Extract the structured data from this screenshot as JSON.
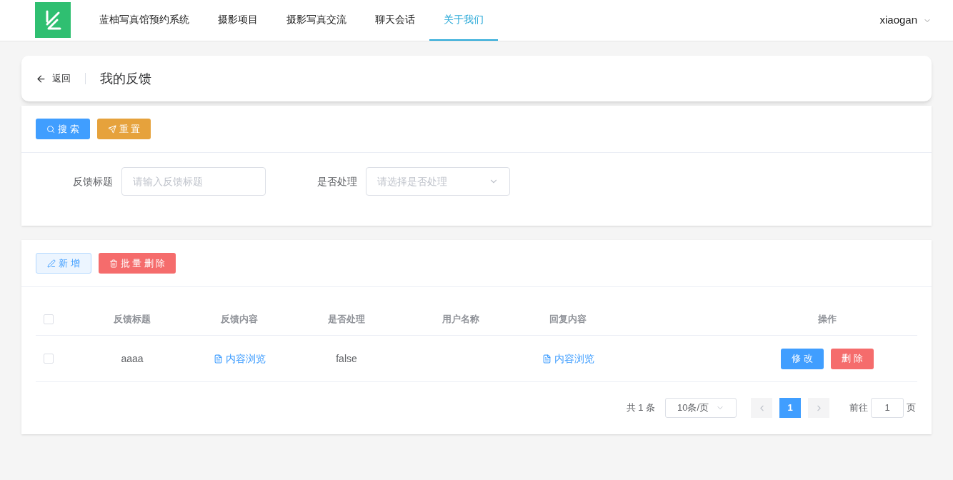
{
  "nav": {
    "items": [
      {
        "label": "蓝柚写真馆预约系统",
        "selected": false
      },
      {
        "label": "摄影项目",
        "selected": false
      },
      {
        "label": "摄影写真交流",
        "selected": false
      },
      {
        "label": "聊天会话",
        "selected": false
      },
      {
        "label": "关于我们",
        "selected": true
      }
    ],
    "user": "xiaogan"
  },
  "page_header": {
    "back": "返回",
    "title": "我的反馈"
  },
  "search_panel": {
    "buttons": [
      {
        "kind": "search",
        "label": "搜 索"
      },
      {
        "kind": "reset",
        "label": "重 置"
      }
    ],
    "fields": [
      {
        "kind": "input",
        "label": "反馈标题",
        "placeholder": "请输入反馈标题"
      },
      {
        "kind": "select",
        "label": "是否处理",
        "placeholder": "请选择是否处理"
      }
    ]
  },
  "toolbar": {
    "buttons": [
      {
        "kind": "add",
        "label": "新 增"
      },
      {
        "kind": "batch_delete",
        "label": "批 量 删 除"
      }
    ]
  },
  "table": {
    "columns": [
      "反馈标题",
      "反馈内容",
      "是否处理",
      "用户名称",
      "回复内容",
      "操作"
    ],
    "rows": [
      {
        "checked": false,
        "title": "aaaa",
        "content": "内容浏览",
        "handled": "false",
        "user": "",
        "reply": "内容浏览",
        "actions": [
          {
            "kind": "edit",
            "label": "修 改"
          },
          {
            "kind": "delete",
            "label": "删 除"
          }
        ]
      }
    ],
    "header_checked": false
  },
  "pagination": {
    "total": "共 1 条",
    "page_size": "10条/页",
    "pages": [
      {
        "label": "1",
        "selected": true
      }
    ],
    "goto_label": "前往",
    "goto_value": "1",
    "goto_suffix": "页"
  }
}
